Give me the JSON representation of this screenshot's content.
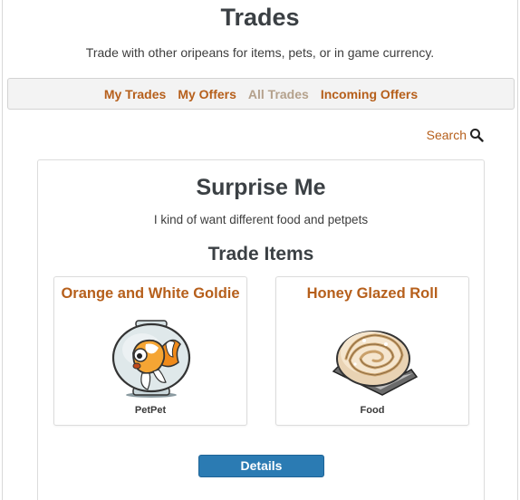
{
  "page": {
    "title": "Trades",
    "subtitle": "Trade with other oripeans for items, pets, or in game currency."
  },
  "nav": {
    "items": [
      {
        "label": "My Trades",
        "active": false
      },
      {
        "label": "My Offers",
        "active": false
      },
      {
        "label": "All Trades",
        "active": true
      },
      {
        "label": "Incoming Offers",
        "active": false
      }
    ]
  },
  "search": {
    "label": "Search",
    "icon": "search-icon"
  },
  "trade": {
    "title": "Surprise Me",
    "description": "I kind of want different food and petpets",
    "items_heading": "Trade Items",
    "items": [
      {
        "name": "Orange and White Goldie",
        "type": "PetPet",
        "image": "goldfish-bowl-image"
      },
      {
        "name": "Honey Glazed Roll",
        "type": "Food",
        "image": "honey-roll-image"
      }
    ],
    "details_label": "Details"
  },
  "colors": {
    "link": "#b65f1b",
    "link_active": "#b4a18c",
    "button": "#2b7bb3",
    "heading": "#3b4044"
  }
}
